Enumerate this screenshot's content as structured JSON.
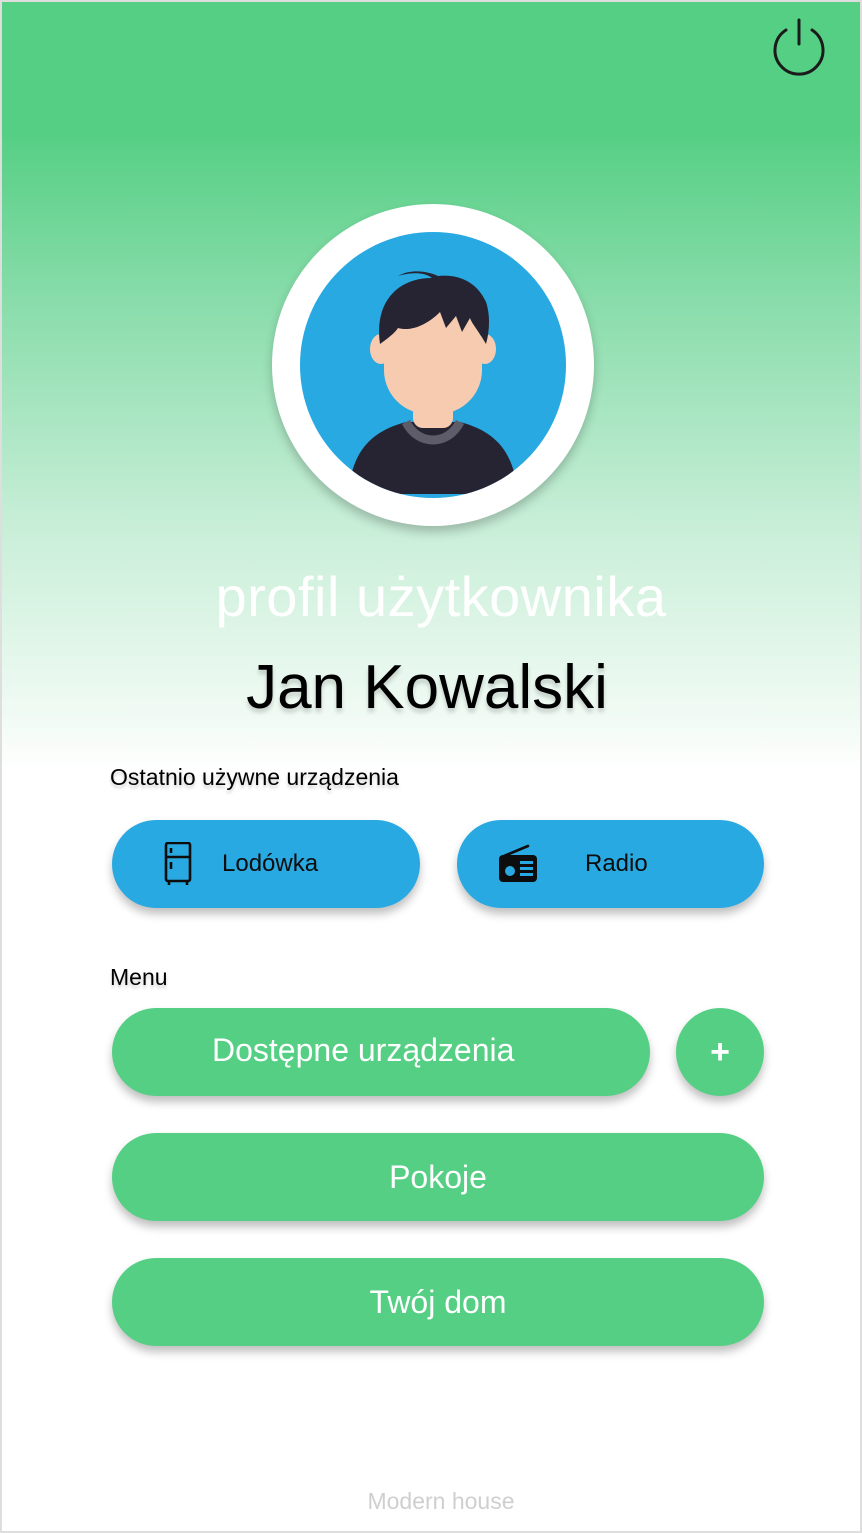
{
  "header": {
    "power_icon": "power-icon",
    "profile_heading": "profil użytkownika",
    "user_name": "Jan Kowalski"
  },
  "avatar": {
    "icon": "user-avatar-icon"
  },
  "recent_devices": {
    "label": "Ostatnio używne urządzenia",
    "items": [
      {
        "label": "Lodówka",
        "icon": "fridge-icon"
      },
      {
        "label": "Radio",
        "icon": "radio-icon"
      }
    ]
  },
  "menu": {
    "label": "Menu",
    "items": [
      {
        "label": "Dostępne urządzenia"
      },
      {
        "label": "+"
      },
      {
        "label": "Pokoje"
      },
      {
        "label": "Twój dom"
      }
    ]
  },
  "footer": {
    "text": "Modern house"
  },
  "colors": {
    "green": "#55cf84",
    "blue": "#29a9e1",
    "dark": "#262433"
  }
}
